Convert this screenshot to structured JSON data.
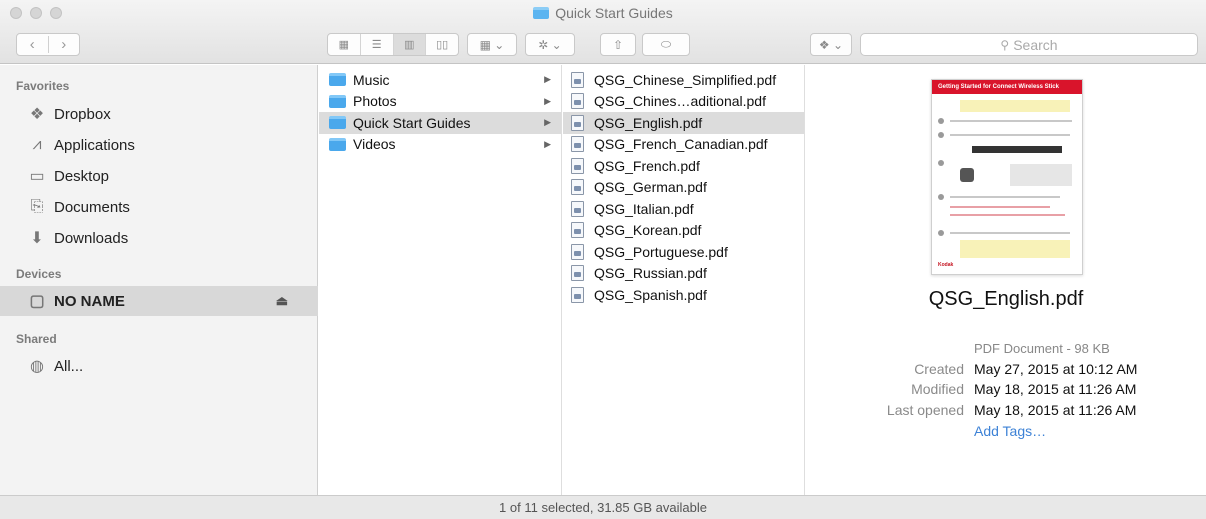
{
  "window": {
    "title": "Quick Start Guides"
  },
  "toolbar": {
    "back_icon": "chevron-left-icon",
    "forward_icon": "chevron-right-icon",
    "search_placeholder": "Search"
  },
  "sidebar": {
    "favorites_heading": "Favorites",
    "favorites": [
      {
        "label": "Dropbox",
        "icon": "dropbox-icon"
      },
      {
        "label": "Applications",
        "icon": "applications-icon"
      },
      {
        "label": "Desktop",
        "icon": "desktop-icon"
      },
      {
        "label": "Documents",
        "icon": "documents-icon"
      },
      {
        "label": "Downloads",
        "icon": "downloads-icon"
      }
    ],
    "devices_heading": "Devices",
    "devices": [
      {
        "label": "NO NAME",
        "icon": "drive-icon",
        "selected": true
      }
    ],
    "shared_heading": "Shared",
    "shared": [
      {
        "label": "All...",
        "icon": "network-icon"
      }
    ]
  },
  "column1": [
    {
      "label": "Music",
      "selected": false
    },
    {
      "label": "Photos",
      "selected": false
    },
    {
      "label": "Quick Start Guides",
      "selected": true
    },
    {
      "label": "Videos",
      "selected": false
    }
  ],
  "column2": [
    {
      "label": "QSG_Chinese_Simplified.pdf",
      "selected": false
    },
    {
      "label": "QSG_Chines…aditional.pdf",
      "selected": false
    },
    {
      "label": "QSG_English.pdf",
      "selected": true
    },
    {
      "label": "QSG_French_Canadian.pdf",
      "selected": false
    },
    {
      "label": "QSG_French.pdf",
      "selected": false
    },
    {
      "label": "QSG_German.pdf",
      "selected": false
    },
    {
      "label": "QSG_Italian.pdf",
      "selected": false
    },
    {
      "label": "QSG_Korean.pdf",
      "selected": false
    },
    {
      "label": "QSG_Portuguese.pdf",
      "selected": false
    },
    {
      "label": "QSG_Russian.pdf",
      "selected": false
    },
    {
      "label": "QSG_Spanish.pdf",
      "selected": false
    }
  ],
  "preview": {
    "thumbnail_header": "Getting Started for Connect Wireless Stick",
    "thumbnail_logo": "Kodak",
    "file_name": "QSG_English.pdf",
    "kind": "PDF Document - 98 KB",
    "created_label": "Created",
    "created_value": "May 27, 2015 at 10:12 AM",
    "modified_label": "Modified",
    "modified_value": "May 18, 2015 at 11:26 AM",
    "opened_label": "Last opened",
    "opened_value": "May 18, 2015 at 11:26 AM",
    "add_tags": "Add Tags…"
  },
  "status": {
    "text": "1 of 11 selected, 31.85 GB available"
  },
  "colors": {
    "folder": "#4aa8ec",
    "link": "#3d82d6",
    "selection": "#dcdcdc"
  }
}
